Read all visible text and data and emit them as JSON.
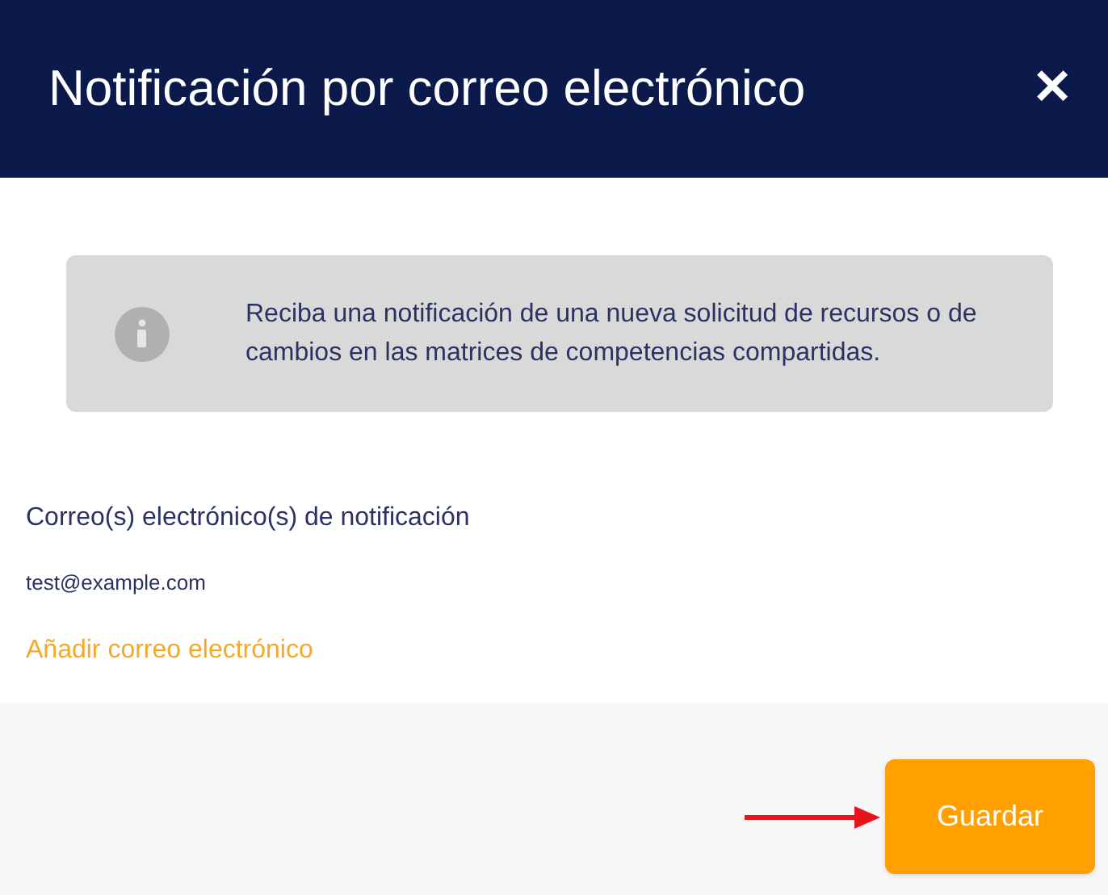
{
  "dialog": {
    "title": "Notificación por correo electrónico",
    "close": "✕"
  },
  "info": {
    "text": "Reciba una notificación de una nueva solicitud de recursos o de cambios en las matrices de competencias compartidas."
  },
  "emails_label": "Correo(s) electrónico(s) de notificación",
  "emails": [
    "test@example.com"
  ],
  "add_link": "Añadir correo electrónico",
  "buttons": [
    {
      "label": "Guardar"
    }
  ]
}
